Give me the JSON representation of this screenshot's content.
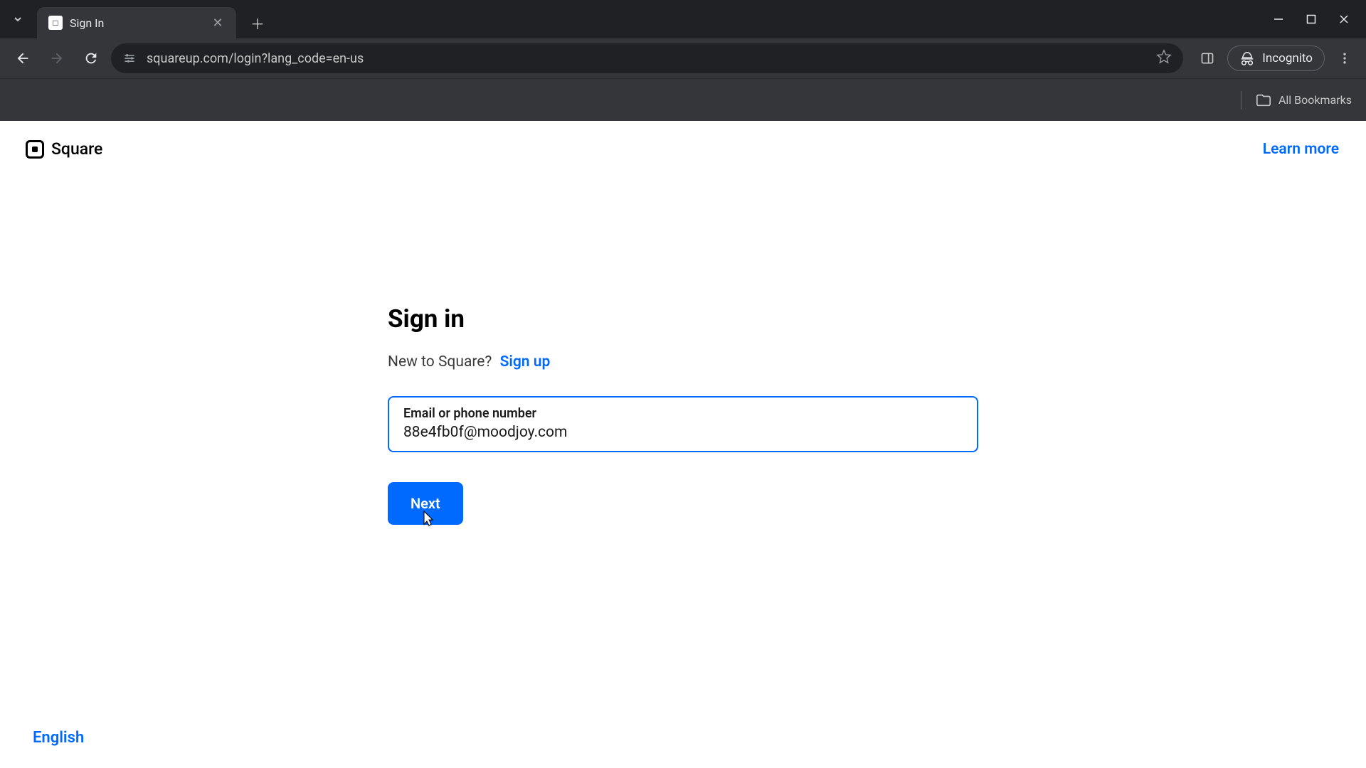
{
  "browser": {
    "tab": {
      "title": "Sign In",
      "favicon_glyph": "□"
    },
    "url": "squareup.com/login?lang_code=en-us",
    "incognito_label": "Incognito",
    "all_bookmarks_label": "All Bookmarks"
  },
  "header": {
    "logo_text": "Square",
    "learn_more": "Learn more"
  },
  "signin": {
    "heading": "Sign in",
    "prompt_prefix": "New to Square?",
    "signup_link": "Sign up",
    "input_label": "Email or phone number",
    "input_value": "88e4fb0f@moodjoy.com",
    "next_button": "Next"
  },
  "footer": {
    "language": "English"
  },
  "colors": {
    "accent": "#006aff",
    "chrome_bg": "#202124",
    "chrome_surface": "#35363a"
  }
}
